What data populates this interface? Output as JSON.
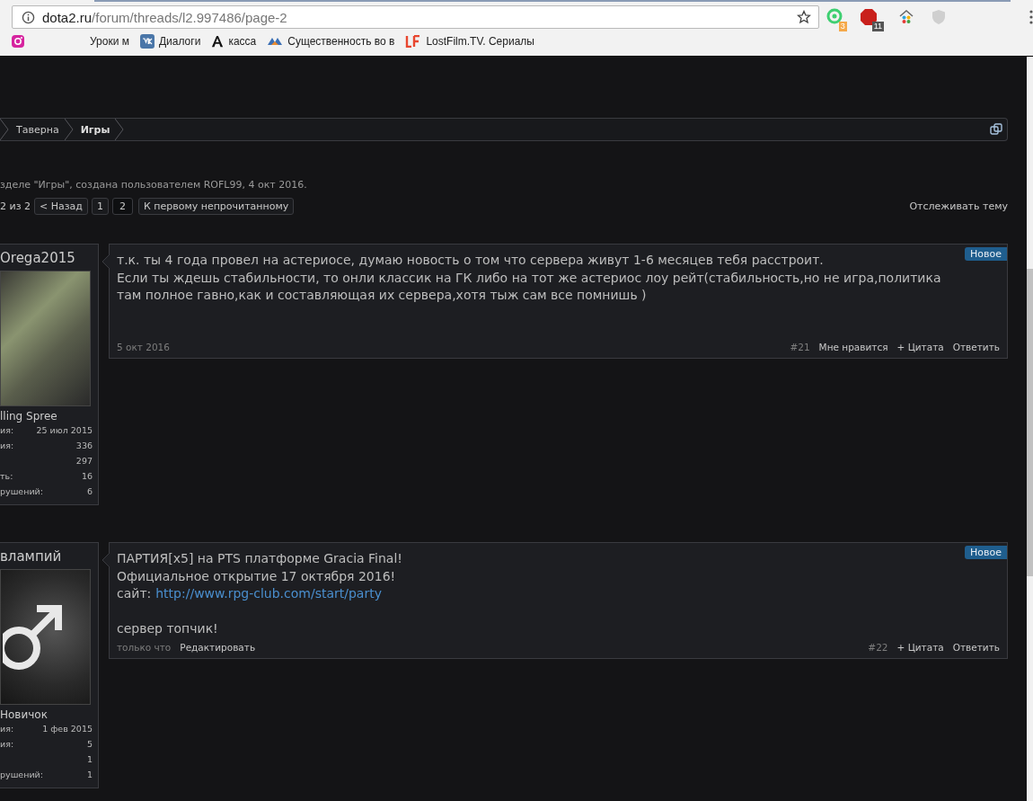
{
  "browser": {
    "url_host": "dota2.ru",
    "url_path": "/forum/threads/l2.997486/page-2",
    "extensions": [
      {
        "kind": "grammar",
        "badge": "3"
      },
      {
        "kind": "adblock",
        "badge": "11"
      },
      {
        "kind": "home"
      },
      {
        "kind": "shield"
      }
    ],
    "bookmarks": [
      {
        "kind": "instagram"
      },
      {
        "kind": "blank",
        "label": "Уроки м"
      },
      {
        "kind": "vk",
        "label": "Диалоги"
      },
      {
        "kind": "letter",
        "label": "касса"
      },
      {
        "kind": "bird",
        "label": "Существенность во в"
      },
      {
        "kind": "lf",
        "label": "LostFilm.TV. Сериалы"
      }
    ]
  },
  "breadcrumbs": [
    {
      "label": "Таверна",
      "current": false
    },
    {
      "label": "Игры",
      "current": true
    }
  ],
  "thread_info": "зделе \"Игры\", создана пользователем ROFL99, 4 окт 2016.",
  "pagination": {
    "label": "2 из 2",
    "buttons": [
      {
        "label": "< Назад",
        "selected": false
      },
      {
        "label": "1",
        "selected": false
      },
      {
        "label": "2",
        "selected": true
      }
    ],
    "unread": "К первому непрочитанному"
  },
  "watch_link": "Отслеживать тему",
  "posts": [
    {
      "username": "Orega2015",
      "avatar": {
        "kind": "photo"
      },
      "rank": "lling Spree",
      "stats": [
        {
          "label": "ия:",
          "value": "25 июл 2015"
        },
        {
          "label": "ия:",
          "value": "336"
        },
        {
          "value": "297"
        },
        {
          "label": "ть:",
          "value": "16"
        },
        {
          "label": "рушений:",
          "value": "6"
        }
      ],
      "badge": "Новое",
      "paragraphs": [
        [
          {
            "text": "т.к. ты 4 года провел на астериосе, думаю новость о том что сервера живут 1-6 месяцев тебя расстроит."
          },
          {
            "text": "Если ты ждешь стабильности, то онли классик на ГК либо на тот же астериос лоу рейт(стабильность,но не игра,политика там полное гавно,как и составляющая их сервера,хотя тыж сам все помнишь )"
          }
        ]
      ],
      "date": "5 окт 2016",
      "number": "#21",
      "actions": [
        "Мне нравится",
        "+ Цитата",
        "Ответить"
      ]
    },
    {
      "username": "влампий",
      "avatar": {
        "kind": "male-symbol"
      },
      "rank": "Новичок",
      "stats": [
        {
          "label": "ия:",
          "value": "1 фев 2015"
        },
        {
          "label": "ия:",
          "value": "5"
        },
        {
          "value": "1"
        },
        {
          "label": "рушений:",
          "value": "1"
        }
      ],
      "badge": "Новое",
      "paragraphs": [
        [
          {
            "text": "ПАРТИЯ[x5] на PTS платформе Gracia Final!"
          },
          {
            "text": "Официальное открытие 17 октября 2016!"
          },
          {
            "text": "сайт:",
            "link": "http://www.rpg-club.com/start/party"
          }
        ],
        [
          {
            "text": "сервер топчик!"
          }
        ]
      ],
      "date": "только что",
      "edit": "Редактировать",
      "number": "#22",
      "actions": [
        "+ Цитата",
        "Ответить"
      ]
    }
  ]
}
